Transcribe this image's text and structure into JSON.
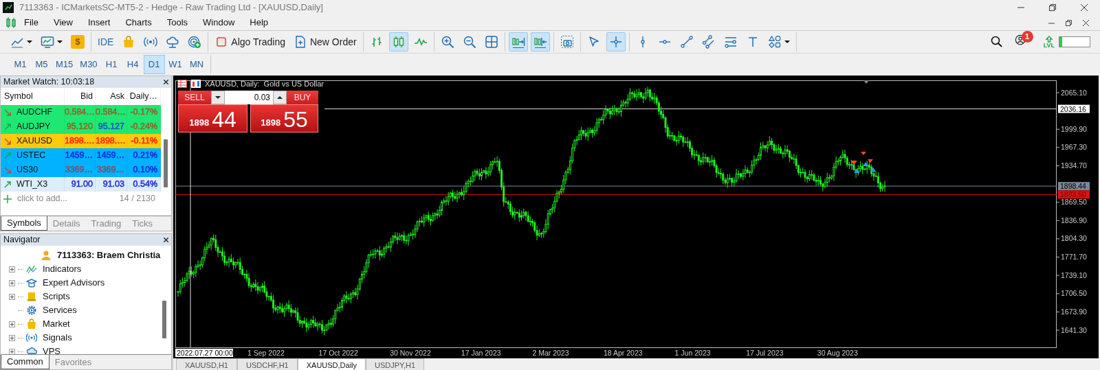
{
  "window": {
    "title": "7113363 - ICMarketsSC-MT5-2 - Hedge - Raw Trading Ltd - [XAUUSD,Daily]"
  },
  "menu": [
    "File",
    "View",
    "Insert",
    "Charts",
    "Tools",
    "Window",
    "Help"
  ],
  "toolbar": {
    "groups": [
      [
        {
          "kind": "dropdown",
          "selected": false
        },
        {
          "kind": "dropdown",
          "selected": false
        },
        {
          "kind": "glyph",
          "label": "$",
          "selected": false
        }
      ],
      [
        {
          "kind": "text",
          "label": "IDE",
          "selected": false
        },
        {
          "kind": "icon",
          "selected": false
        },
        {
          "kind": "icon",
          "selected": false
        },
        {
          "kind": "icon",
          "selected": false
        },
        {
          "kind": "icon",
          "selected": false
        }
      ],
      [
        {
          "kind": "labeled",
          "label": "Algo Trading",
          "selected": false
        },
        {
          "kind": "labeled",
          "label": "New Order",
          "selected": false
        }
      ],
      [
        {
          "kind": "icon",
          "selected": false
        },
        {
          "kind": "icon",
          "selected": true
        },
        {
          "kind": "icon",
          "selected": false
        }
      ],
      [
        {
          "kind": "icon",
          "selected": false
        },
        {
          "kind": "icon",
          "selected": false
        },
        {
          "kind": "icon",
          "selected": false
        }
      ],
      [
        {
          "kind": "icon",
          "selected": true
        },
        {
          "kind": "icon",
          "selected": true
        }
      ],
      [
        {
          "kind": "icon",
          "selected": false
        }
      ],
      [
        {
          "kind": "icon",
          "selected": false
        },
        {
          "kind": "icon",
          "selected": true
        }
      ],
      [
        {
          "kind": "icon",
          "selected": false
        },
        {
          "kind": "icon",
          "selected": false
        },
        {
          "kind": "icon",
          "selected": false
        },
        {
          "kind": "icon",
          "selected": false
        },
        {
          "kind": "icon",
          "selected": false
        },
        {
          "kind": "icon",
          "selected": false
        },
        {
          "kind": "dropdown",
          "selected": false
        }
      ]
    ],
    "notification_count": "1",
    "level_label": "LVL",
    "level": 0.1
  },
  "timeframes": [
    {
      "label": "M1",
      "selected": false
    },
    {
      "label": "M5",
      "selected": false
    },
    {
      "label": "M15",
      "selected": false
    },
    {
      "label": "M30",
      "selected": false
    },
    {
      "label": "H1",
      "selected": false
    },
    {
      "label": "H4",
      "selected": false
    },
    {
      "label": "D1",
      "selected": true
    },
    {
      "label": "W1",
      "selected": false
    },
    {
      "label": "MN",
      "selected": false
    }
  ],
  "market_watch": {
    "title": "Market Watch: 10:03:18",
    "columns": [
      "Symbol",
      "Bid",
      "Ask",
      "Daily…"
    ],
    "rows": [
      {
        "symbol": "AUDCHF",
        "kind": "down",
        "color": "#1ee873",
        "bid": {
          "value": "0.584…",
          "color": "#8a6a2a"
        },
        "ask": {
          "value": "0.584…",
          "color": "#8a6a2a"
        },
        "daily": {
          "value": "-0.17%",
          "color": "#8a6a2a"
        }
      },
      {
        "symbol": "AUDJPY",
        "kind": "up",
        "color": "#1ee873",
        "bid": {
          "value": "95.120",
          "color": "#8a6a2a"
        },
        "ask": {
          "value": "95.127",
          "color": "#1a55d0"
        },
        "daily": {
          "value": "-0.24%",
          "color": "#8a6a2a"
        }
      },
      {
        "symbol": "XAUUSD",
        "kind": "down",
        "color": "#ffc90e",
        "bid": {
          "value": "1898.…",
          "color": "#ff2a00"
        },
        "ask": {
          "value": "1898.…",
          "color": "#ff2a00"
        },
        "daily": {
          "value": "-0.11%",
          "color": "#ff2a00"
        }
      },
      {
        "symbol": "USTEC",
        "kind": "up",
        "color": "#00b2ff",
        "bid": {
          "value": "1459…",
          "color": "#1a2ee0"
        },
        "ask": {
          "value": "1459…",
          "color": "#1a2ee0"
        },
        "daily": {
          "value": "0.21%",
          "color": "#1a2ee0"
        }
      },
      {
        "symbol": "US30",
        "kind": "down",
        "color": "#00b2ff",
        "bid": {
          "value": "3369…",
          "color": "#7a5560"
        },
        "ask": {
          "value": "3369…",
          "color": "#7a5560"
        },
        "daily": {
          "value": "0.10%",
          "color": "#1a2ee0"
        }
      },
      {
        "symbol": "WTI_X3",
        "kind": "up",
        "color": "#dcedfb",
        "bid": {
          "value": "91.00",
          "color": "#2a2ee0"
        },
        "ask": {
          "value": "91.03",
          "color": "#2a2ee0"
        },
        "daily": {
          "value": "0.54%",
          "color": "#2a2ee0"
        }
      }
    ],
    "add_label": "click to add...",
    "count": "14 / 2130",
    "tabs": [
      {
        "label": "Symbols",
        "selected": true
      },
      {
        "label": "Details",
        "selected": false
      },
      {
        "label": "Trading",
        "selected": false
      },
      {
        "label": "Ticks",
        "selected": false
      }
    ]
  },
  "navigator": {
    "title": "Navigator",
    "account": "7113363: Braem Christia",
    "items": [
      {
        "label": "Indicators",
        "expandable": true
      },
      {
        "label": "Expert Advisors",
        "expandable": true
      },
      {
        "label": "Scripts",
        "expandable": true
      },
      {
        "label": "Services",
        "expandable": false
      },
      {
        "label": "Market",
        "expandable": true
      },
      {
        "label": "Signals",
        "expandable": true
      },
      {
        "label": "VPS",
        "expandable": true
      }
    ],
    "tabs": [
      {
        "label": "Common",
        "selected": true
      },
      {
        "label": "Favorites",
        "selected": false
      }
    ]
  },
  "chart": {
    "title": "XAUUSD, Daily:  Gold vs US Dollar",
    "trade_panel": {
      "sell": "SELL",
      "buy": "BUY",
      "volume": "0.03",
      "sell_price": {
        "prefix": "1898",
        "digits": "44"
      },
      "buy_price": {
        "prefix": "1898",
        "digits": "55"
      }
    },
    "price_axis": [
      "2065.10",
      "1999.90",
      "1967.30",
      "1934.70",
      "1869.50",
      "1836.90",
      "1804.30",
      "1771.70",
      "1739.10",
      "1706.50",
      "1673.90",
      "1641.30"
    ],
    "price_tags": [
      {
        "label": "2036.16",
        "kind": "level"
      },
      {
        "label": "1898.44",
        "kind": "bid"
      },
      {
        "label": "1883.50",
        "kind": "stop"
      }
    ],
    "time_axis": {
      "cursor_label": "2022.07.27 00:00",
      "labels": [
        "1 Sep 2022",
        "17 Oct 2022",
        "30 Nov 2022",
        "17 Jan 2023",
        "2 Mar 2023",
        "18 Apr 2023",
        "1 Jun 2023",
        "17 Jul 2023",
        "30 Aug 2023"
      ]
    }
  },
  "chart_tabs": [
    {
      "label": "XAUUSD,H1",
      "selected": false
    },
    {
      "label": "USDCHF,H1",
      "selected": false
    },
    {
      "label": "XAUUSD,Daily",
      "selected": true
    },
    {
      "label": "USDJPY,H1",
      "selected": false
    }
  ]
}
